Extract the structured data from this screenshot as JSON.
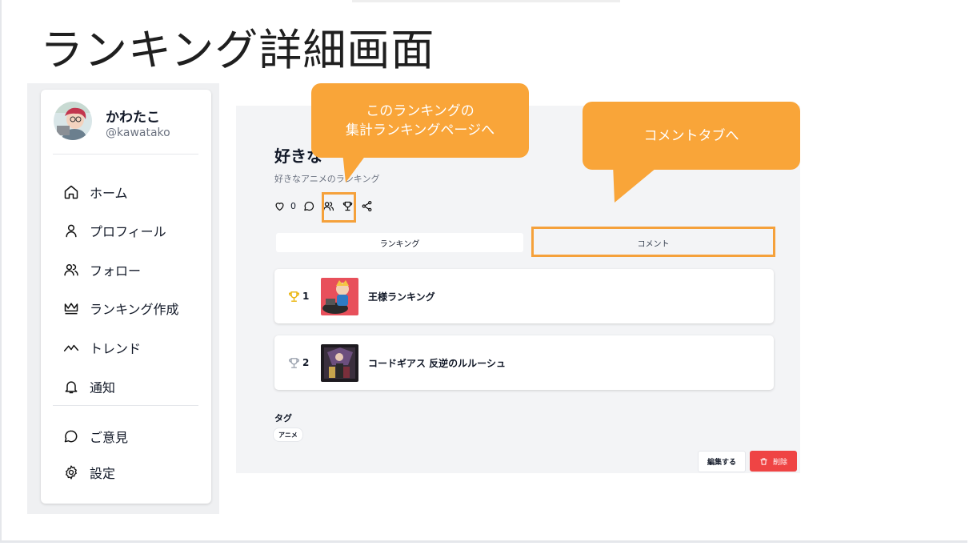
{
  "slide": {
    "title": "ランキング詳細画面"
  },
  "sidebar": {
    "user": {
      "name": "かわたこ",
      "handle": "@kawatako"
    },
    "items": [
      {
        "label": "ホーム",
        "icon": "home-icon"
      },
      {
        "label": "プロフィール",
        "icon": "user-icon"
      },
      {
        "label": "フォロー",
        "icon": "users-icon"
      },
      {
        "label": "ランキング作成",
        "icon": "crown-icon"
      },
      {
        "label": "トレンド",
        "icon": "trending-icon"
      },
      {
        "label": "通知",
        "icon": "bell-icon"
      }
    ],
    "footer_items": [
      {
        "label": "ご意見",
        "icon": "message-icon"
      },
      {
        "label": "設定",
        "icon": "gear-icon"
      }
    ]
  },
  "ranking": {
    "title": "好きな",
    "description": "好きなアニメのランキング",
    "like_count": "0",
    "tabs": [
      {
        "label": "ランキング"
      },
      {
        "label": "コメント"
      }
    ],
    "items": [
      {
        "rank": "1",
        "title": "王様ランキング",
        "trophy_color": "#eab308"
      },
      {
        "rank": "2",
        "title": "コードギアス 反逆のルルーシュ",
        "trophy_color": "#9ca3af"
      }
    ],
    "tags_label": "タグ",
    "tags": [
      "アニメ"
    ],
    "edit_label": "編集する",
    "delete_label": "削除"
  },
  "annotations": {
    "aggregate_callout": "このランキングの\n集計ランキングページへ",
    "comment_callout": "コメントタブへ",
    "accent_color": "#f9a539"
  }
}
